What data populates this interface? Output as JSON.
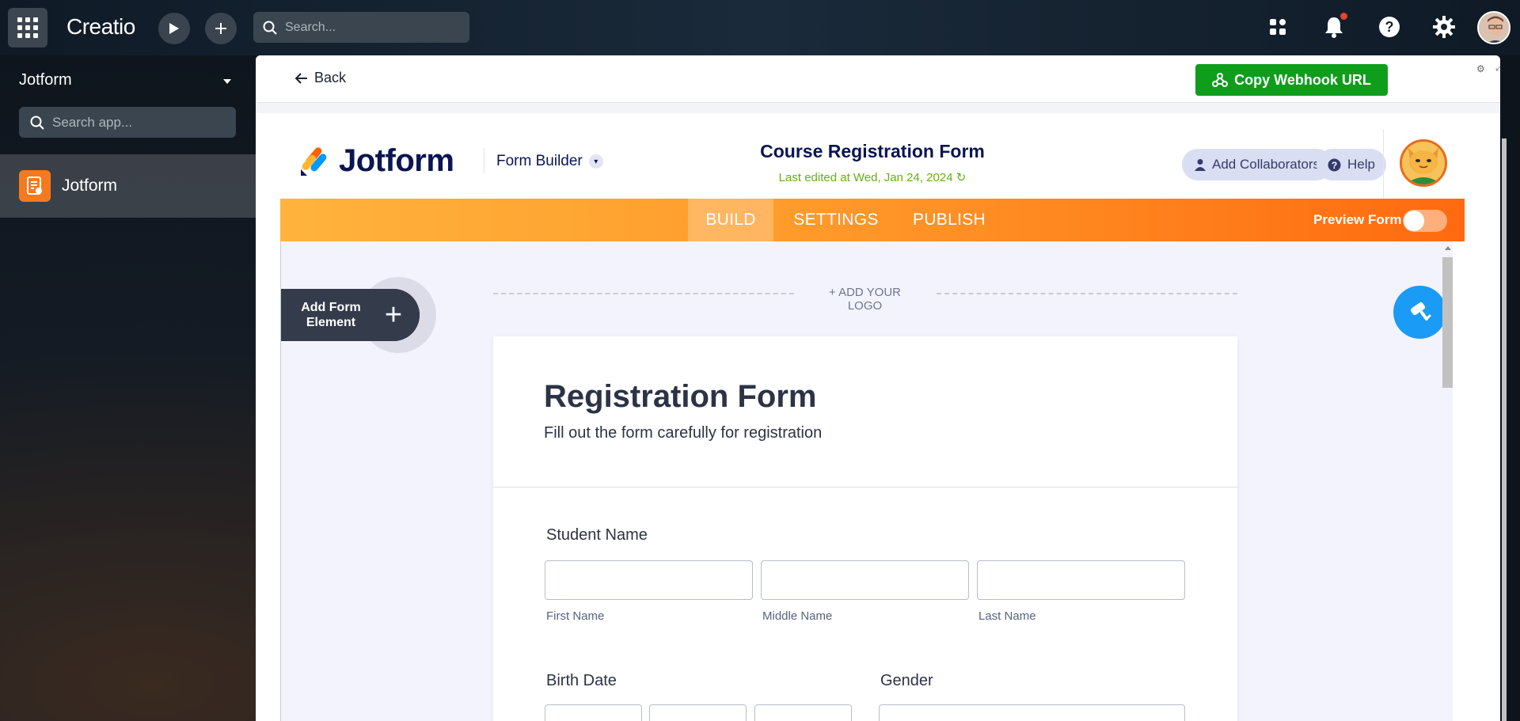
{
  "topbar": {
    "brand": "Creatio",
    "search_placeholder": "Search..."
  },
  "sidebar": {
    "title": "Jotform",
    "search_placeholder": "Search app...",
    "items": [
      {
        "label": "Jotform"
      }
    ]
  },
  "backbar": {
    "back_label": "Back",
    "webhook_label": "Copy Webhook URL"
  },
  "jotform_header": {
    "logo_text": "Jotform",
    "builder_label": "Form Builder",
    "form_title": "Course Registration Form",
    "last_edited": "Last edited at Wed, Jan 24, 2024",
    "collaborators_label": "Add Collaborators",
    "help_label": "Help"
  },
  "nav": {
    "tabs": [
      {
        "label": "BUILD",
        "active": true
      },
      {
        "label": "SETTINGS",
        "active": false
      },
      {
        "label": "PUBLISH",
        "active": false
      }
    ],
    "preview_label": "Preview Form",
    "preview_on": false
  },
  "canvas": {
    "add_element_label": "Add Form Element",
    "add_logo_label": "+ ADD YOUR LOGO"
  },
  "form": {
    "title": "Registration Form",
    "subtitle": "Fill out the form carefully for registration",
    "fields": {
      "student_name": {
        "label": "Student Name",
        "sub_labels": [
          "First Name",
          "Middle Name",
          "Last Name"
        ]
      },
      "birth_date": {
        "label": "Birth Date"
      },
      "gender": {
        "label": "Gender"
      }
    }
  },
  "colors": {
    "webhook_button": "#0f9d1c",
    "nav_gradient_start": "#ffb33d",
    "nav_gradient_end": "#ff6a10",
    "paint_button": "#1a9bf5",
    "jotform_navy": "#0a1551",
    "last_edited_green": "#64b20f",
    "sidebar_app_icon": "#f57a1f"
  },
  "icons": {
    "apps": "grid-icon",
    "run": "play-icon",
    "add": "plus-icon",
    "search": "search-icon",
    "apps_menu": "apps-icon",
    "notifications": "bell-icon",
    "help": "help-icon",
    "settings": "gear-icon"
  }
}
